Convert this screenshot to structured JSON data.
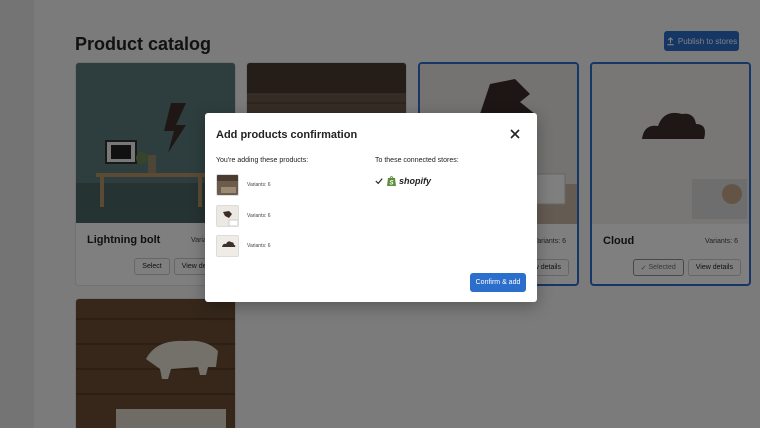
{
  "page": {
    "title": "Product catalog",
    "publish_label": "Publish to stores"
  },
  "products": [
    {
      "name": "Lightning bolt",
      "variants": "Variants: 6",
      "select_label": "Select",
      "details_label": "View details",
      "selected": false
    },
    {
      "name": "",
      "variants": "",
      "selected": false
    },
    {
      "name": "",
      "variants": "Variants: 6",
      "details_label": "View details",
      "selected": true
    },
    {
      "name": "Cloud",
      "variants": "Variants: 6",
      "selected_label": "Selected",
      "details_label": "View details",
      "selected": true
    },
    {
      "name": "",
      "variants": "",
      "selected": false
    }
  ],
  "modal": {
    "title": "Add products confirmation",
    "products_heading": "You're adding these products:",
    "stores_heading": "To these connected stores:",
    "items": [
      {
        "variants": "Variants: 6"
      },
      {
        "variants": "Variants: 6"
      },
      {
        "variants": "Variants: 6"
      }
    ],
    "store_name": "shopify",
    "confirm_label": "Confirm & add"
  },
  "colors": {
    "accent": "#2c6ecb",
    "overlay": "rgba(0,0,0,0.5)"
  }
}
